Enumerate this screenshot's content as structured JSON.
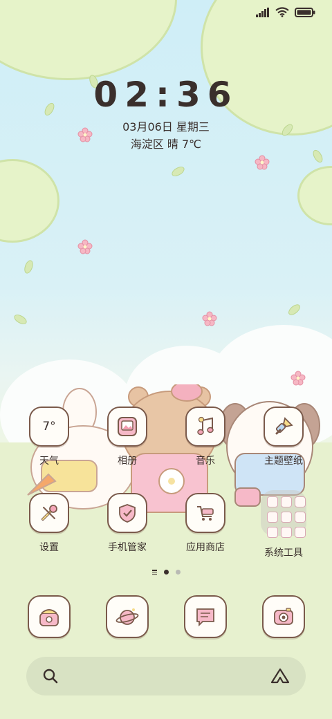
{
  "status_bar": {
    "icons": [
      "signal-icon",
      "wifi-icon",
      "battery-icon"
    ]
  },
  "lockscreen": {
    "time": "02:36",
    "date": "03月06日 星期三",
    "location_weather": "海淀区 晴 7℃"
  },
  "apps": [
    {
      "label": "天气",
      "icon": "weather-icon",
      "value": "7°"
    },
    {
      "label": "相册",
      "icon": "gallery-icon"
    },
    {
      "label": "音乐",
      "icon": "music-icon"
    },
    {
      "label": "主题壁纸",
      "icon": "theme-brush-icon"
    },
    {
      "label": "设置",
      "icon": "settings-tools-icon"
    },
    {
      "label": "手机管家",
      "icon": "security-shield-icon"
    },
    {
      "label": "应用商店",
      "icon": "app-store-cart-icon"
    },
    {
      "label": "系统工具",
      "icon": "folder-icon"
    }
  ],
  "pages": {
    "count": 2,
    "active": 0
  },
  "dock": [
    {
      "icon": "phone-icon"
    },
    {
      "icon": "browser-planet-icon"
    },
    {
      "icon": "messages-icon"
    },
    {
      "icon": "camera-icon"
    }
  ],
  "search": {
    "left_icon": "search-icon",
    "right_icon": "assistant-icon"
  },
  "colors": {
    "outline": "#7a5a4b",
    "pink": "#f2a7b8",
    "yellow": "#f6dc8a",
    "sky": "#cfeef7"
  }
}
